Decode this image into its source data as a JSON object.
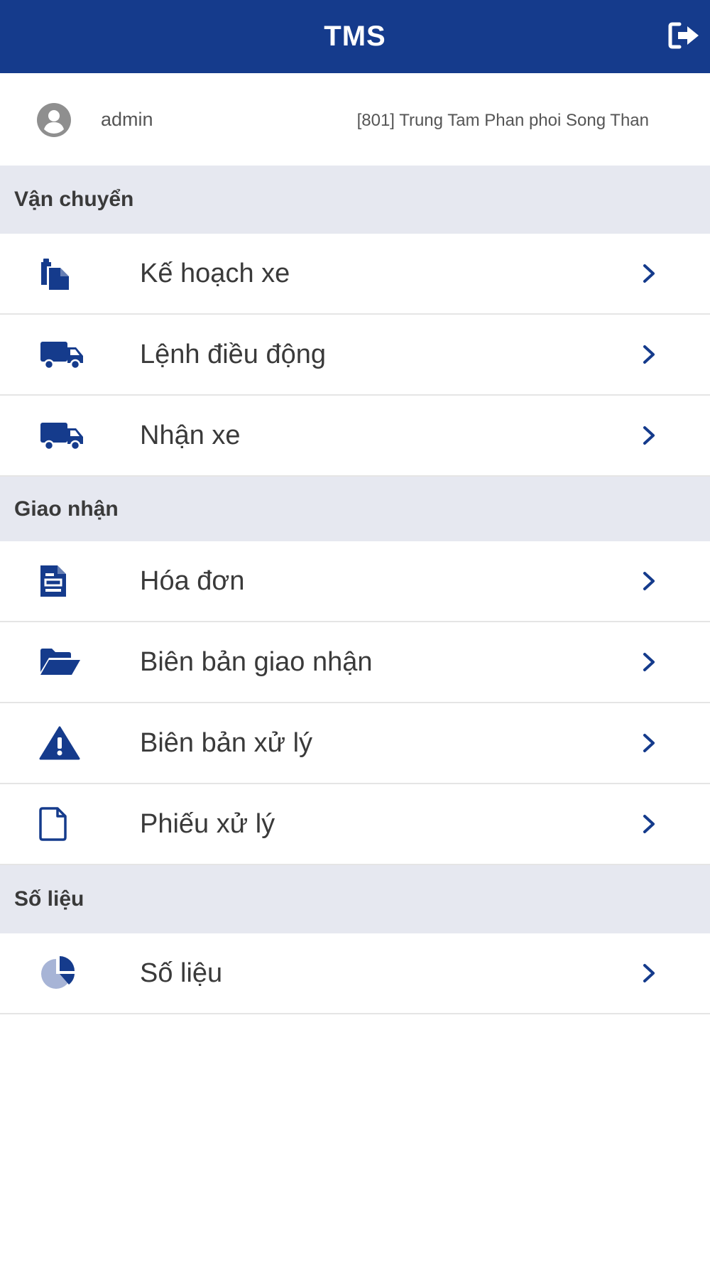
{
  "header": {
    "title": "TMS",
    "logout_icon": "logout-icon"
  },
  "user": {
    "name": "admin",
    "site": "[801] Trung Tam Phan phoi Song Than",
    "avatar_icon": "user-circle-icon"
  },
  "sections": [
    {
      "title": "Vận chuyển",
      "items": [
        {
          "label": "Kế hoạch xe",
          "icon": "clipboard-copy-icon"
        },
        {
          "label": "Lệnh điều động",
          "icon": "truck-icon"
        },
        {
          "label": "Nhận xe",
          "icon": "truck-icon"
        }
      ]
    },
    {
      "title": "Giao nhận",
      "items": [
        {
          "label": "Hóa đơn",
          "icon": "invoice-file-icon"
        },
        {
          "label": "Biên bản giao nhận",
          "icon": "folder-open-icon"
        },
        {
          "label": "Biên bản xử lý",
          "icon": "warning-icon"
        },
        {
          "label": "Phiếu xử lý",
          "icon": "file-outline-icon"
        }
      ]
    },
    {
      "title": "Số liệu",
      "items": [
        {
          "label": "Số liệu",
          "icon": "pie-chart-icon"
        }
      ]
    }
  ],
  "colors": {
    "primary": "#153b8c",
    "section_bg": "#e6e8f0",
    "icon_light": "#a7b4d6"
  }
}
